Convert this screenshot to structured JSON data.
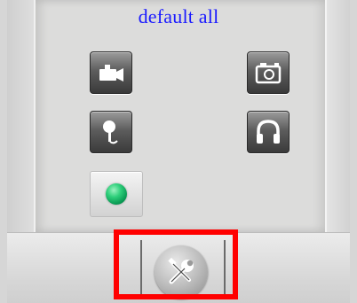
{
  "header": {
    "title": "default all"
  },
  "controls": [
    {
      "name": "video-record",
      "icon": "video-camera-icon"
    },
    {
      "name": "snapshot",
      "icon": "photo-camera-icon"
    },
    {
      "name": "microphone",
      "icon": "microphone-icon"
    },
    {
      "name": "audio-listen",
      "icon": "headphones-icon"
    },
    {
      "name": "status",
      "icon": "green-led-icon",
      "color": "#2fd07b"
    }
  ],
  "settings": {
    "icon": "tools-icon",
    "highlight_color": "#ff0000"
  }
}
